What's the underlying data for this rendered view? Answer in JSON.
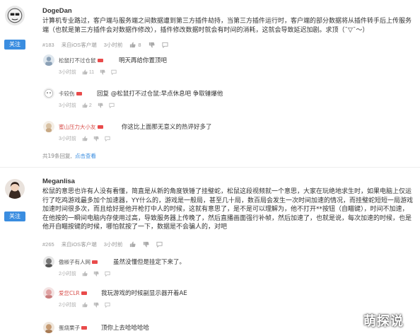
{
  "post1": {
    "username": "DogeDan",
    "follow_label": "关注",
    "content": "计算机专业路过，客户端与服务端之间数据遭到第三方插件劫持，当第三方插件运行时，客户端的部分数据将从插件转手后上传服务端（也就是第三方插件会对数据作修改），插件修改数据时就会有时间的消耗，这就会导致延迟加剧。求顶（¯▽¯～）",
    "floor": "#183",
    "device": "来自iOS客户端",
    "time": "3小时前",
    "likes": "8",
    "replies": [
      {
        "name": "松鼠打不过仓鼠",
        "text": "明天再给你置顶吧",
        "time": "3小时前",
        "likes": "11",
        "red": false
      },
      {
        "name": "卡较伤",
        "text": "回复 @松鼠打不过仓鼠:早点休息吧 争取锤爆他",
        "time": "3小时前",
        "likes": "2",
        "red": false
      },
      {
        "name": "蜜山压力大小友",
        "text": "你这比上面那无意义的热评好多了",
        "time": "3小时前",
        "likes": "",
        "red": true
      }
    ],
    "more_text": "共19条回复,",
    "more_link": "点击查看"
  },
  "post2": {
    "username": "Meganlisa",
    "follow_label": "关注",
    "content": "松鼠的意思也许有人没有看懂，简直是从新的角度铁锤了挂璧蛇，松鼠这段视频就一个意思，大家在玩绝地求生时，如果电脑上仅运行了吃鸡游戏最多加个加速器，YY什么的，游戏是一般局，甚至几十局，数百局会发生一次时间加速的情况，而挂璧蛇短短一局游戏加速时间很多次，而且给好是他开枪打中人的时候，这就有意思了，是不是可以理解为，他不打开**按钮（自瞄键），时间不加速，在他按的一瞬间电脑内存使用过高，导致服务器上传晚了，然后直播画面强行补帧，然后加速了，也就是说，每次加速的时候，也是他开自瞄按键的时候，哪怕就按了一下，数据是不会骗人的，对吧",
    "floor": "#265",
    "device": "来自iOS客户端",
    "time": "3小时前",
    "likes": "",
    "replies": [
      {
        "name": "傲椒子有人网",
        "text": "虽然没懂但是挂定下来了。",
        "time": "2小时前",
        "likes": "",
        "red": false
      },
      {
        "name": "爱您CLR",
        "text": "我玩游戏的时候副显示器开着AE",
        "time": "2小时前",
        "likes": "",
        "red": true
      },
      {
        "name": "蛋烧栗子",
        "text": "顶你上去哈哈哈哈",
        "time": "",
        "likes": "",
        "red": false
      }
    ]
  },
  "watermark": "萌探说"
}
